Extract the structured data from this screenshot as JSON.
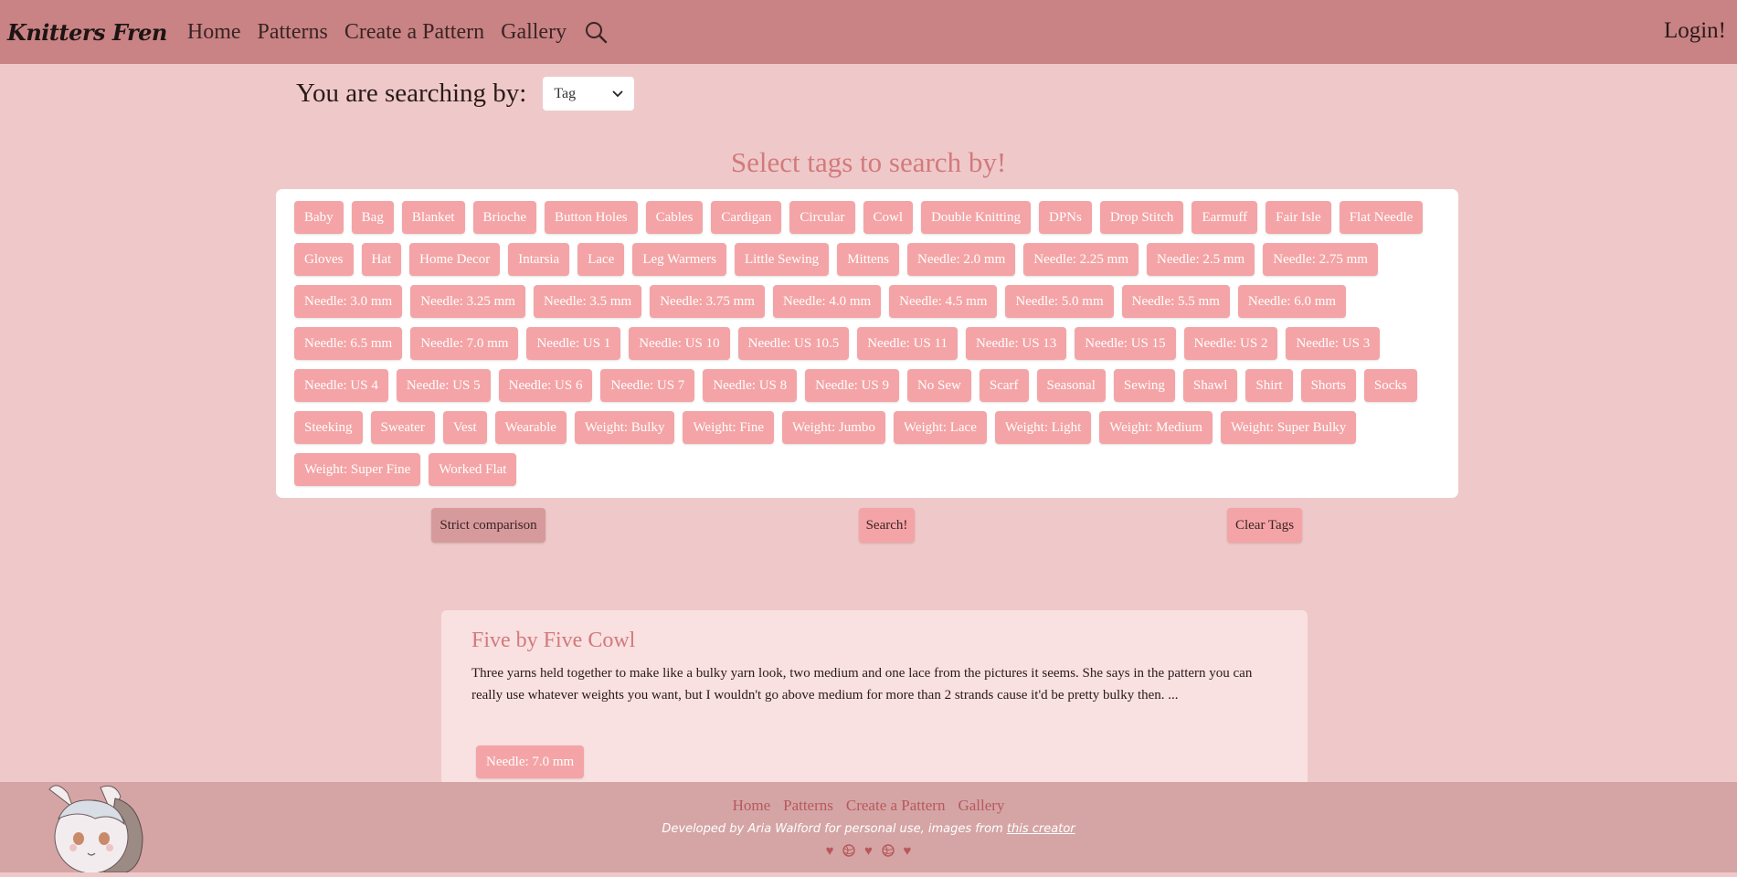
{
  "navbar": {
    "brand": "Knitters Fren",
    "links": [
      "Home",
      "Patterns",
      "Create a Pattern",
      "Gallery"
    ],
    "search_icon": "search-icon",
    "login": "Login!"
  },
  "search_by": {
    "label": "You are searching by:",
    "selected": "Tag"
  },
  "heading": "Select tags to search by!",
  "tags": [
    "Baby",
    "Bag",
    "Blanket",
    "Brioche",
    "Button Holes",
    "Cables",
    "Cardigan",
    "Circular",
    "Cowl",
    "Double Knitting",
    "DPNs",
    "Drop Stitch",
    "Earmuff",
    "Fair Isle",
    "Flat Needle",
    "Gloves",
    "Hat",
    "Home Decor",
    "Intarsia",
    "Lace",
    "Leg Warmers",
    "Little Sewing",
    "Mittens",
    "Needle: 2.0 mm",
    "Needle: 2.25 mm",
    "Needle: 2.5 mm",
    "Needle: 2.75 mm",
    "Needle: 3.0 mm",
    "Needle: 3.25 mm",
    "Needle: 3.5 mm",
    "Needle: 3.75 mm",
    "Needle: 4.0 mm",
    "Needle: 4.5 mm",
    "Needle: 5.0 mm",
    "Needle: 5.5 mm",
    "Needle: 6.0 mm",
    "Needle: 6.5 mm",
    "Needle: 7.0 mm",
    "Needle: US 1",
    "Needle: US 10",
    "Needle: US 10.5",
    "Needle: US 11",
    "Needle: US 13",
    "Needle: US 15",
    "Needle: US 2",
    "Needle: US 3",
    "Needle: US 4",
    "Needle: US 5",
    "Needle: US 6",
    "Needle: US 7",
    "Needle: US 8",
    "Needle: US 9",
    "No Sew",
    "Scarf",
    "Seasonal",
    "Sewing",
    "Shawl",
    "Shirt",
    "Shorts",
    "Socks",
    "Steeking",
    "Sweater",
    "Vest",
    "Wearable",
    "Weight: Bulky",
    "Weight: Fine",
    "Weight: Jumbo",
    "Weight: Lace",
    "Weight: Light",
    "Weight: Medium",
    "Weight: Super Bulky",
    "Weight: Super Fine",
    "Worked Flat"
  ],
  "buttons": {
    "strict": "Strict comparison",
    "search": "Search!",
    "clear": "Clear Tags"
  },
  "card": {
    "title": "Five by Five Cowl",
    "description": "Three yarns held together to make like a bulky yarn look, two medium and one lace from the pictures it seems. She says in the pattern you can really use whatever weights you want, but I wouldn't go above medium for more than 2 strands cause it'd be pretty bulky then. ...",
    "tag": "Needle: 7.0 mm"
  },
  "footer": {
    "links": [
      "Home",
      "Patterns",
      "Create a Pattern",
      "Gallery"
    ],
    "credit_prefix": "Developed by Aria Walford for personal use, images from ",
    "credit_link": "this creator",
    "icons": [
      "heart-icon",
      "yarn-icon",
      "heart-icon",
      "yarn-icon",
      "heart-icon"
    ]
  },
  "colors": {
    "navbar": "#c98384",
    "background": "#efc9c9",
    "tag": "#f4a4a6",
    "accent": "#d27a7c",
    "footer": "#d5a5a6"
  }
}
